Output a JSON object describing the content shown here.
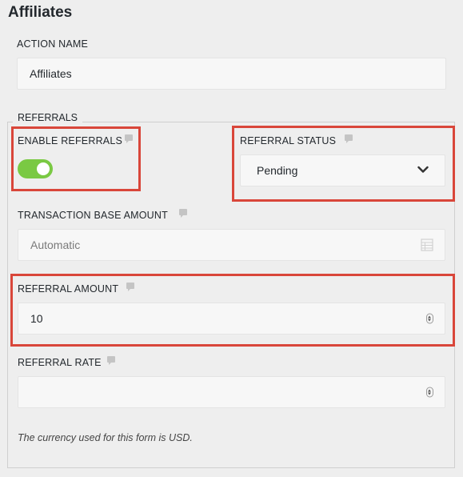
{
  "page": {
    "title": "Affiliates"
  },
  "action_name": {
    "label": "ACTION NAME",
    "value": "Affiliates"
  },
  "referrals": {
    "legend": "REFERRALS",
    "enable_referrals": {
      "label": "ENABLE REFERRALS",
      "enabled": true,
      "toggle_color": "#7ac943"
    },
    "referral_status": {
      "label": "REFERRAL STATUS",
      "selected": "Pending"
    },
    "transaction_base_amount": {
      "label": "TRANSACTION BASE AMOUNT",
      "placeholder": "Automatic",
      "icon": "calculator-icon"
    },
    "referral_amount": {
      "label": "REFERRAL AMOUNT",
      "value": "10"
    },
    "referral_rate": {
      "label": "REFERRAL RATE",
      "value": ""
    },
    "currency_note": "The currency used for this form is USD."
  },
  "colors": {
    "highlight": "#d9463a",
    "background": "#eeeeee",
    "field_bg": "#f7f7f7"
  }
}
